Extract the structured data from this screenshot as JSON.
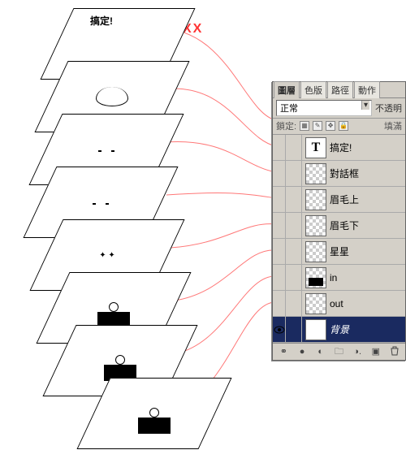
{
  "annotation": "XX",
  "top_sheet_label": "搞定!",
  "panel": {
    "tabs": [
      "圖層",
      "色版",
      "路徑",
      "動作"
    ],
    "active_tab_index": 0,
    "blend_mode": "正常",
    "opacity_label": "不透明",
    "lock_label": "鎖定:",
    "fill_label": "填滿",
    "layers": [
      {
        "name": "搞定!",
        "thumb": "text",
        "visible": false,
        "selected": false
      },
      {
        "name": "對話框",
        "thumb": "checker",
        "visible": false,
        "selected": false
      },
      {
        "name": "眉毛上",
        "thumb": "checker",
        "visible": false,
        "selected": false
      },
      {
        "name": "眉毛下",
        "thumb": "checker",
        "visible": false,
        "selected": false
      },
      {
        "name": "星星",
        "thumb": "checker",
        "visible": false,
        "selected": false
      },
      {
        "name": "in",
        "thumb": "checker-fig",
        "visible": false,
        "selected": false
      },
      {
        "name": "out",
        "thumb": "checker",
        "visible": false,
        "selected": false
      },
      {
        "name": "背景",
        "thumb": "plain",
        "visible": true,
        "selected": true
      }
    ],
    "footer_icons": [
      "link-icon",
      "fx-icon",
      "mask-icon",
      "folder-icon",
      "adjust-icon",
      "new-icon",
      "trash-icon"
    ]
  },
  "sheets": [
    {
      "idx": 0,
      "content": "label"
    },
    {
      "idx": 1,
      "content": "bubble"
    },
    {
      "idx": 2,
      "content": "eyebrows"
    },
    {
      "idx": 3,
      "content": "eyebrows"
    },
    {
      "idx": 4,
      "content": "stars"
    },
    {
      "idx": 5,
      "content": "figure"
    },
    {
      "idx": 6,
      "content": "figure"
    },
    {
      "idx": 7,
      "content": "figure"
    }
  ]
}
